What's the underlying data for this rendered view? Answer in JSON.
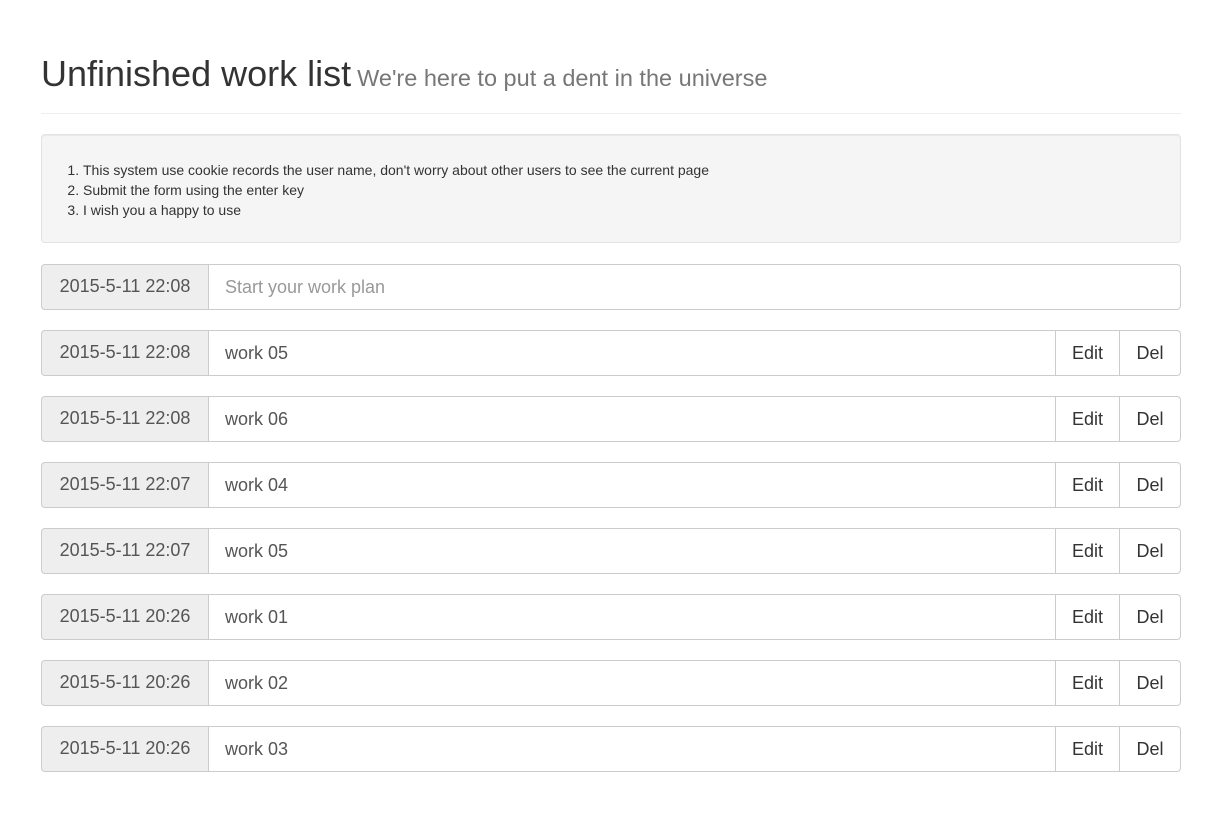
{
  "header": {
    "title": "Unfinished work list",
    "subtitle": "We're here to put a dent in the universe"
  },
  "notes": [
    "This system use cookie records the user name, don't worry about other users to see the current page",
    "Submit the form using the enter key",
    "I wish you a happy to use"
  ],
  "new_task": {
    "time": "2015-5-11 22:08",
    "placeholder": "Start your work plan",
    "value": ""
  },
  "actions": {
    "edit_label": "Edit",
    "delete_label": "Del"
  },
  "tasks": [
    {
      "time": "2015-5-11 22:08",
      "text": "work 05"
    },
    {
      "time": "2015-5-11 22:08",
      "text": "work 06"
    },
    {
      "time": "2015-5-11 22:07",
      "text": "work 04"
    },
    {
      "time": "2015-5-11 22:07",
      "text": "work 05"
    },
    {
      "time": "2015-5-11 20:26",
      "text": "work 01"
    },
    {
      "time": "2015-5-11 20:26",
      "text": "work 02"
    },
    {
      "time": "2015-5-11 20:26",
      "text": "work 03"
    }
  ]
}
